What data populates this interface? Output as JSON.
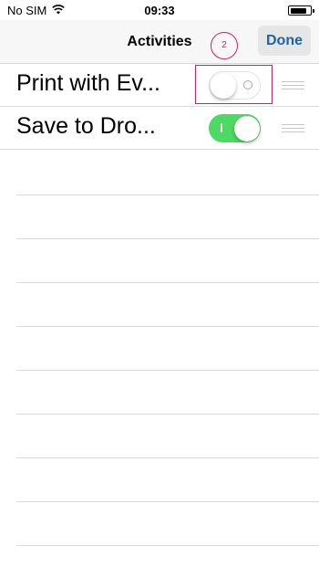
{
  "status_bar": {
    "carrier": "No SIM",
    "time": "09:33",
    "battery_percent": 85
  },
  "nav": {
    "title": "Activities",
    "done_label": "Done",
    "step_marker": "2"
  },
  "activities": [
    {
      "label": "Print with Ev...",
      "enabled": false
    },
    {
      "label": "Save to Dro...",
      "enabled": true
    }
  ],
  "colors": {
    "toggle_on": "#4cd964",
    "done_text": "#1f63a6",
    "annotation": "#d61f5a"
  }
}
